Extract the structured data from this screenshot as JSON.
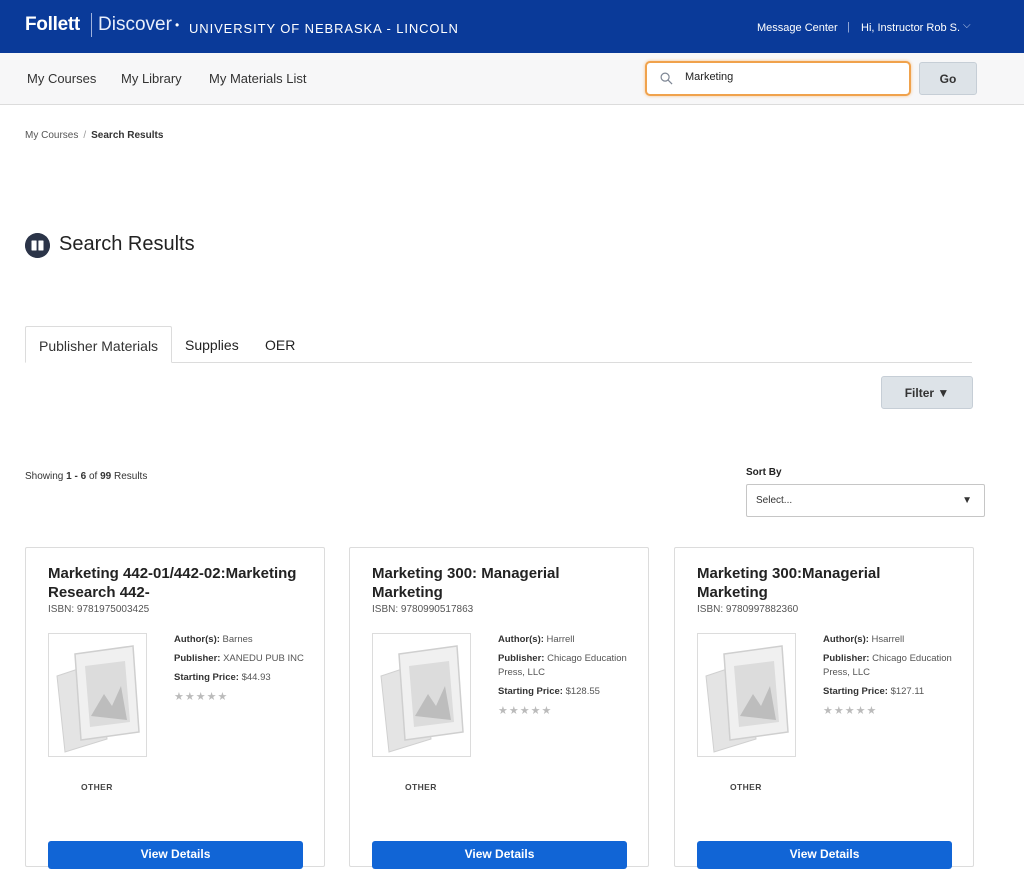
{
  "header": {
    "logo_follett": "Follett",
    "logo_discover": "Discover",
    "logo_dot": "•",
    "school": "UNIVERSITY OF NEBRASKA - LINCOLN",
    "message_center": "Message Center",
    "separator": "|",
    "greeting": "Hi, Instructor Rob S.",
    "chevron": "⌵"
  },
  "nav": {
    "items": [
      "My Courses",
      "My Library",
      "My Materials List"
    ]
  },
  "search": {
    "value": "Marketing",
    "go_label": "Go"
  },
  "breadcrumb": {
    "items": [
      "My Courses",
      "Search Results"
    ],
    "separator": "/"
  },
  "page": {
    "title": "Search Results"
  },
  "tabs": [
    "Publisher Materials",
    "Supplies",
    "OER"
  ],
  "filter": {
    "label": "Filter ▼"
  },
  "results": {
    "showing_prefix": "Showing",
    "range": "1 - 6",
    "of": "of",
    "total": "99",
    "suffix": "Results"
  },
  "sort": {
    "label": "Sort By",
    "value": "Select...",
    "caret": "▼"
  },
  "cards": [
    {
      "title": "Marketing 442-01/442-02:Marketing Research 442-",
      "isbn": "ISBN: 9781975003425",
      "author_label": "Author(s):",
      "author": "Barnes",
      "publisher_label": "Publisher:",
      "publisher": "XANEDU PUB INC",
      "price_label": "Starting Price:",
      "price": "$44.93",
      "stars": "★★★★★",
      "type": "OTHER",
      "button": "View Details"
    },
    {
      "title": "Marketing 300: Managerial Marketing",
      "isbn": "ISBN: 9780990517863",
      "author_label": "Author(s):",
      "author": "Harrell",
      "publisher_label": "Publisher:",
      "publisher": "Chicago Education Press, LLC",
      "price_label": "Starting Price:",
      "price": "$128.55",
      "stars": "★★★★★",
      "type": "OTHER",
      "button": "View Details"
    },
    {
      "title": "Marketing 300:Managerial Marketing",
      "isbn": "ISBN: 9780997882360",
      "author_label": "Author(s):",
      "author": "Hsarrell",
      "publisher_label": "Publisher:",
      "publisher": "Chicago Education Press, LLC",
      "price_label": "Starting Price:",
      "price": "$127.11",
      "stars": "★★★★★",
      "type": "OTHER",
      "button": "View Details"
    }
  ]
}
